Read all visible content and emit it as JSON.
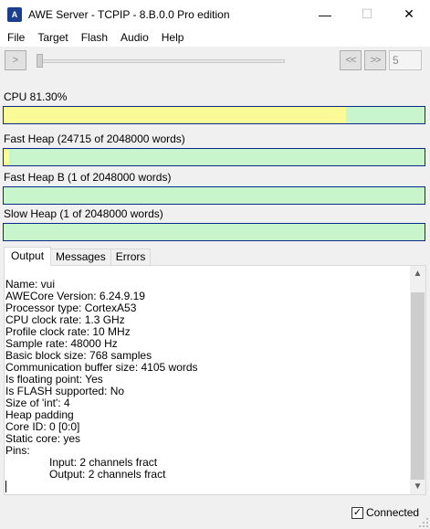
{
  "window": {
    "title": "AWE Server - TCPIP - 8.B.0.0 Pro edition",
    "app_icon_text": "A",
    "minimize_glyph": "—",
    "maximize_glyph": "☐",
    "close_glyph": "✕"
  },
  "menu": [
    "File",
    "Target",
    "Flash",
    "Audio",
    "Help"
  ],
  "toolbar": {
    "play_glyph": ">",
    "prev_glyph": "<<",
    "next_glyph": ">>",
    "frame_value": "5",
    "slider_position": 0
  },
  "meters": {
    "cpu": {
      "label": "CPU 81.30%",
      "fill": 0.813
    },
    "fast_heap": {
      "label": "Fast Heap (24715 of 2048000 words)",
      "fill": 0.012
    },
    "fast_heap_b": {
      "label": "Fast Heap B (1 of 2048000 words)",
      "fill": 0.0
    },
    "slow_heap": {
      "label": "Slow Heap (1 of 2048000 words)",
      "fill": 0.0
    }
  },
  "colors": {
    "meter_fill": "#fafa96",
    "meter_empty": "#c8f5cc",
    "meter_border": "#0a2a8a"
  },
  "tabs": [
    "Output",
    "Messages",
    "Errors"
  ],
  "active_tab": "Output",
  "output_lines": [
    "Name: vui",
    "AWECore Version: 6.24.9.19",
    "Processor type: CortexA53",
    "CPU clock rate: 1.3 GHz",
    "Profile clock rate: 10 MHz",
    "Sample rate: 48000 Hz",
    "Basic block size: 768 samples",
    "Communication buffer size: 4105 words",
    "Is floating point: Yes",
    "Is FLASH supported: No",
    "Size of 'int': 4",
    "Heap padding",
    "Core ID: 0 [0:0]",
    "Static core: yes",
    "Pins:",
    "Input: 2 channels fract",
    "Output: 2 channels fract"
  ],
  "scroll": {
    "up_glyph": "▲",
    "down_glyph": "▼"
  },
  "status": {
    "connected_label": "Connected",
    "connected_checked": true,
    "check_glyph": "✓"
  }
}
